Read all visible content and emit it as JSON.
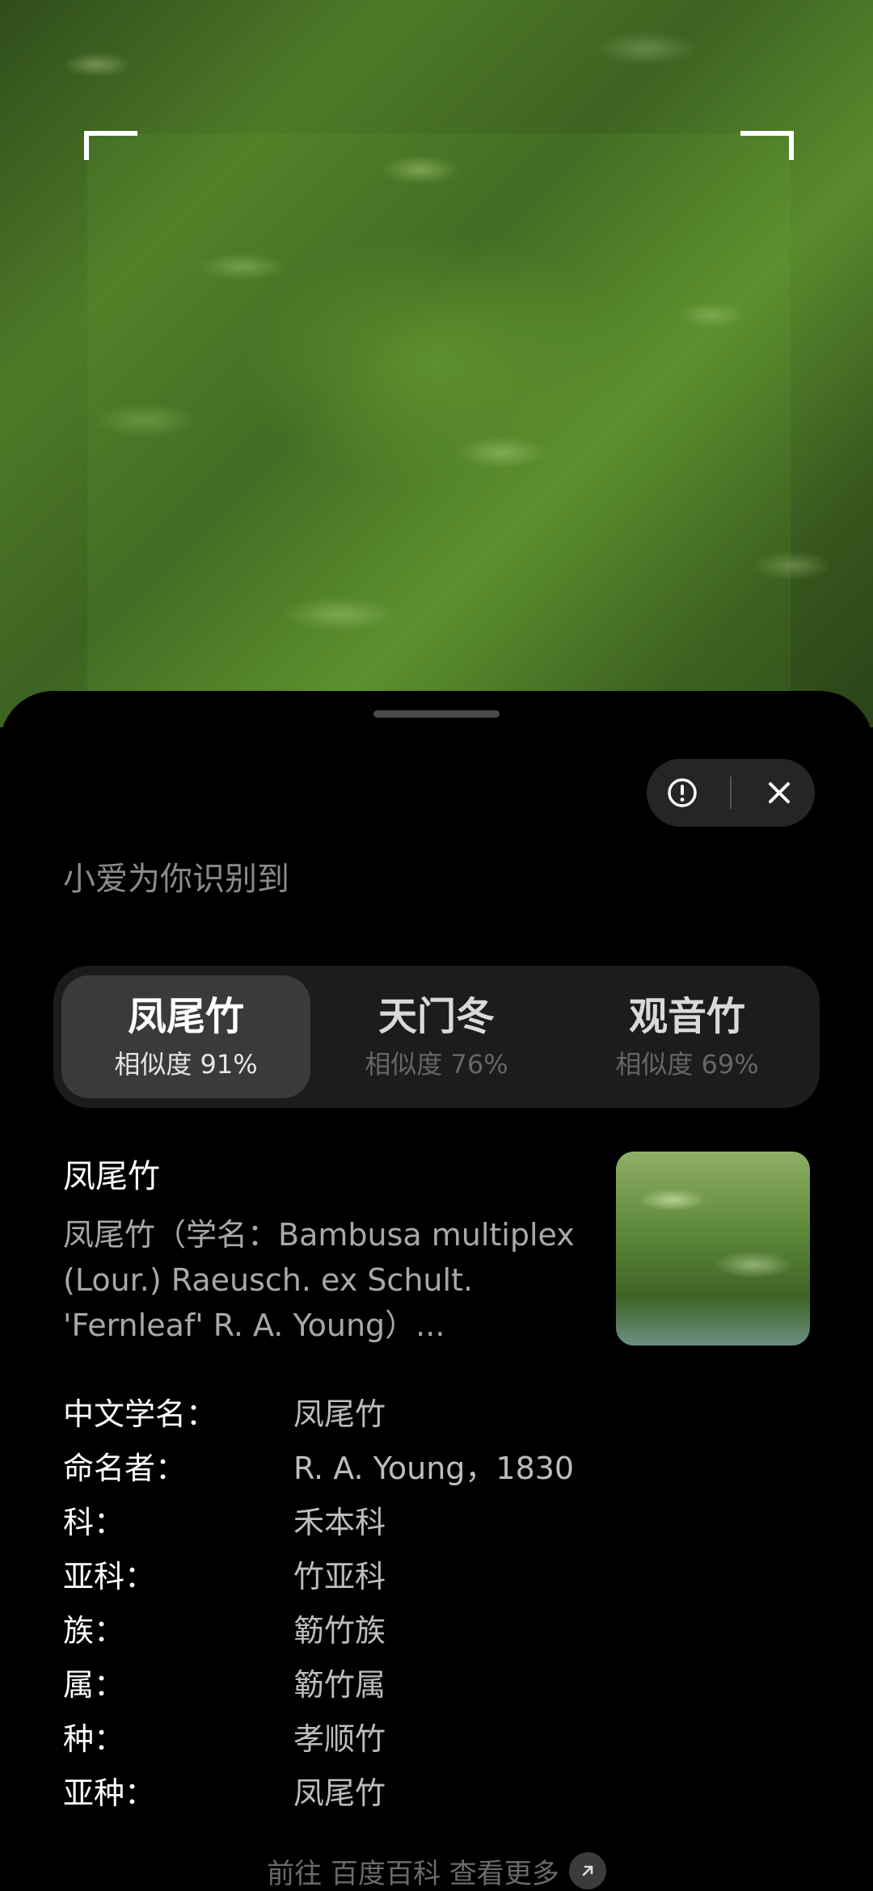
{
  "sheet": {
    "heading": "小爱为你识别到",
    "tabs": [
      {
        "name": "凤尾竹",
        "similarity": "相似度 91%"
      },
      {
        "name": "天门冬",
        "similarity": "相似度 76%"
      },
      {
        "name": "观音竹",
        "similarity": "相似度 69%"
      }
    ],
    "detail": {
      "title": "凤尾竹",
      "description": "凤尾竹（学名：Bambusa multiplex (Lour.) Raeusch. ex Schult. 'Fernleaf' R. A. Young）...",
      "facts": [
        {
          "label": "中文学名：",
          "value": "凤尾竹"
        },
        {
          "label": "命名者：",
          "value": "R. A. Young，1830"
        },
        {
          "label": "科：",
          "value": "禾本科"
        },
        {
          "label": "亚科：",
          "value": "竹亚科"
        },
        {
          "label": "族：",
          "value": "簕竹族"
        },
        {
          "label": "属：",
          "value": "簕竹属"
        },
        {
          "label": "种：",
          "value": "孝顺竹"
        },
        {
          "label": "亚种：",
          "value": "凤尾竹"
        }
      ]
    },
    "footer": "前往 百度百科 查看更多"
  },
  "icons": {
    "feedback": "info-circle-icon",
    "close": "close-icon",
    "external_link": "arrow-up-right-icon"
  }
}
